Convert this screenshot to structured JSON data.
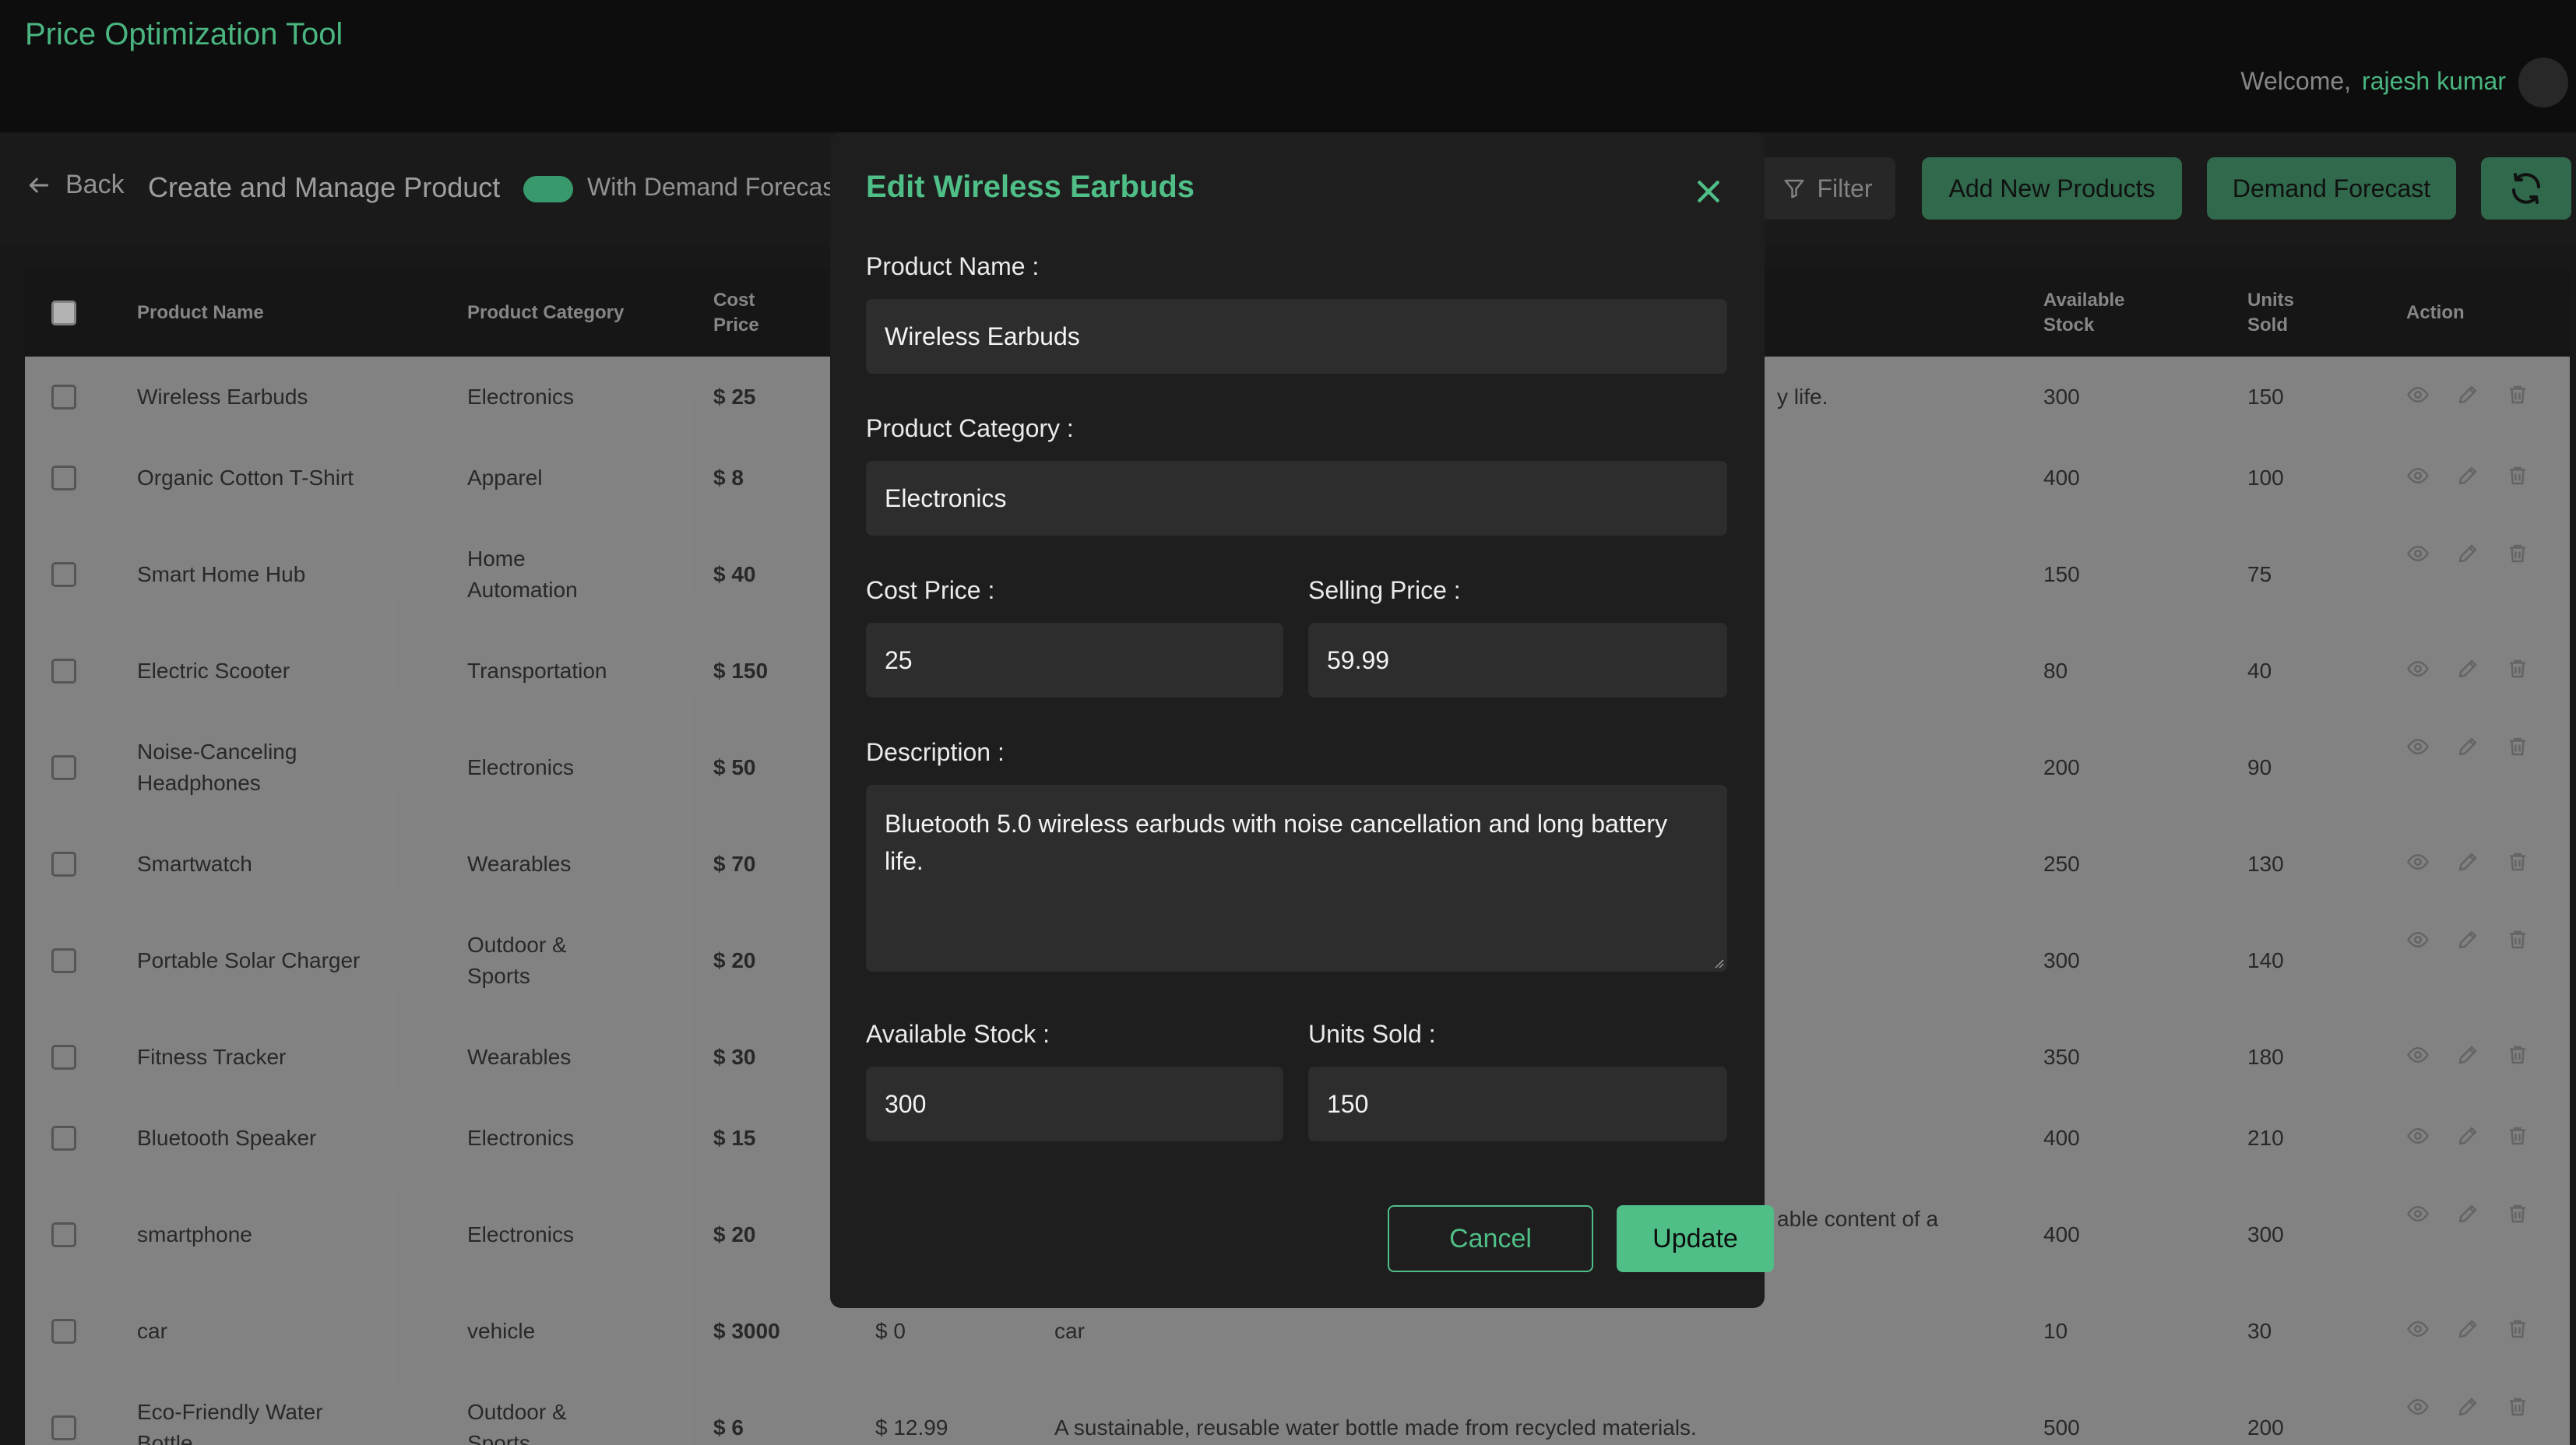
{
  "app": {
    "title": "Price Optimization Tool"
  },
  "header": {
    "welcome": "Welcome,",
    "user_name": "rajesh kumar"
  },
  "toolbar": {
    "back_label": "Back",
    "title": "Create and Manage Product",
    "toggle_label": "With Demand Forecas",
    "toggle_on": true,
    "filter_label": "Filter",
    "add_label": "Add New Products",
    "forecast_label": "Demand Forecast"
  },
  "table": {
    "headers": {
      "name": "Product Name",
      "category": "Product Category",
      "cost_line1": "Cost",
      "cost_line2": "Price",
      "stock_line1": "Available",
      "stock_line2": "Stock",
      "units_line1": "Units",
      "units_line2": "Sold",
      "action": "Action"
    },
    "rows": [
      {
        "name": [
          "Wireless Earbuds"
        ],
        "category": [
          "Electronics"
        ],
        "cost": "$ 25",
        "selling": "",
        "desc": "y life.",
        "stock": "300",
        "units": "150"
      },
      {
        "name": [
          "Organic Cotton T-Shirt"
        ],
        "category": [
          "Apparel"
        ],
        "cost": "$ 8",
        "selling": "",
        "desc": "",
        "stock": "400",
        "units": "100"
      },
      {
        "name": [
          "Smart Home Hub"
        ],
        "category": [
          "Home",
          "Automation"
        ],
        "cost": "$ 40",
        "selling": "",
        "desc": "",
        "stock": "150",
        "units": "75"
      },
      {
        "name": [
          "Electric Scooter"
        ],
        "category": [
          "Transportation"
        ],
        "cost": "$ 150",
        "selling": "",
        "desc": "",
        "stock": "80",
        "units": "40"
      },
      {
        "name": [
          "Noise-Canceling",
          "Headphones"
        ],
        "category": [
          "Electronics"
        ],
        "cost": "$ 50",
        "selling": "",
        "desc": "",
        "stock": "200",
        "units": "90"
      },
      {
        "name": [
          "Smartwatch"
        ],
        "category": [
          "Wearables"
        ],
        "cost": "$ 70",
        "selling": "",
        "desc": "",
        "stock": "250",
        "units": "130"
      },
      {
        "name": [
          "Portable Solar Charger"
        ],
        "category": [
          "Outdoor &",
          "Sports"
        ],
        "cost": "$ 20",
        "selling": "",
        "desc": "",
        "stock": "300",
        "units": "140"
      },
      {
        "name": [
          "Fitness Tracker"
        ],
        "category": [
          "Wearables"
        ],
        "cost": "$ 30",
        "selling": "",
        "desc": "",
        "stock": "350",
        "units": "180"
      },
      {
        "name": [
          "Bluetooth Speaker"
        ],
        "category": [
          "Electronics"
        ],
        "cost": "$ 15",
        "selling": "",
        "desc": "",
        "stock": "400",
        "units": "210"
      },
      {
        "name": [
          "smartphone"
        ],
        "category": [
          "Electronics"
        ],
        "cost": "$ 20",
        "selling": "",
        "desc": "able content of a",
        "stock": "400",
        "units": "300"
      },
      {
        "name": [
          "car"
        ],
        "category": [
          "vehicle"
        ],
        "cost": "$ 3000",
        "selling": "$ 0",
        "desc": "car",
        "stock": "10",
        "units": "30"
      },
      {
        "name": [
          "Eco-Friendly Water",
          "Bottle"
        ],
        "category": [
          "Outdoor &",
          "Sports"
        ],
        "cost": "$ 6",
        "selling": "$ 12.99",
        "desc": "A sustainable, reusable water bottle made from recycled materials.",
        "stock": "500",
        "units": "200"
      }
    ]
  },
  "modal": {
    "title": "Edit Wireless Earbuds",
    "name_label": "Product Name :",
    "name_value": "Wireless Earbuds",
    "category_label": "Product Category :",
    "category_value": "Electronics",
    "cost_label": "Cost Price :",
    "cost_value": "25",
    "selling_label": "Selling Price :",
    "selling_value": "59.99",
    "desc_label": "Description :",
    "desc_value": "Bluetooth 5.0 wireless earbuds with noise cancellation and long battery life.",
    "stock_label": "Available Stock :",
    "stock_value": "300",
    "units_label": "Units Sold :",
    "units_value": "150",
    "cancel_label": "Cancel",
    "update_label": "Update"
  },
  "colors": {
    "accent": "#4fbf87",
    "button_dim": "#336f51",
    "modal_bg": "#1e1e1e",
    "field_bg": "#2d2d2d"
  }
}
